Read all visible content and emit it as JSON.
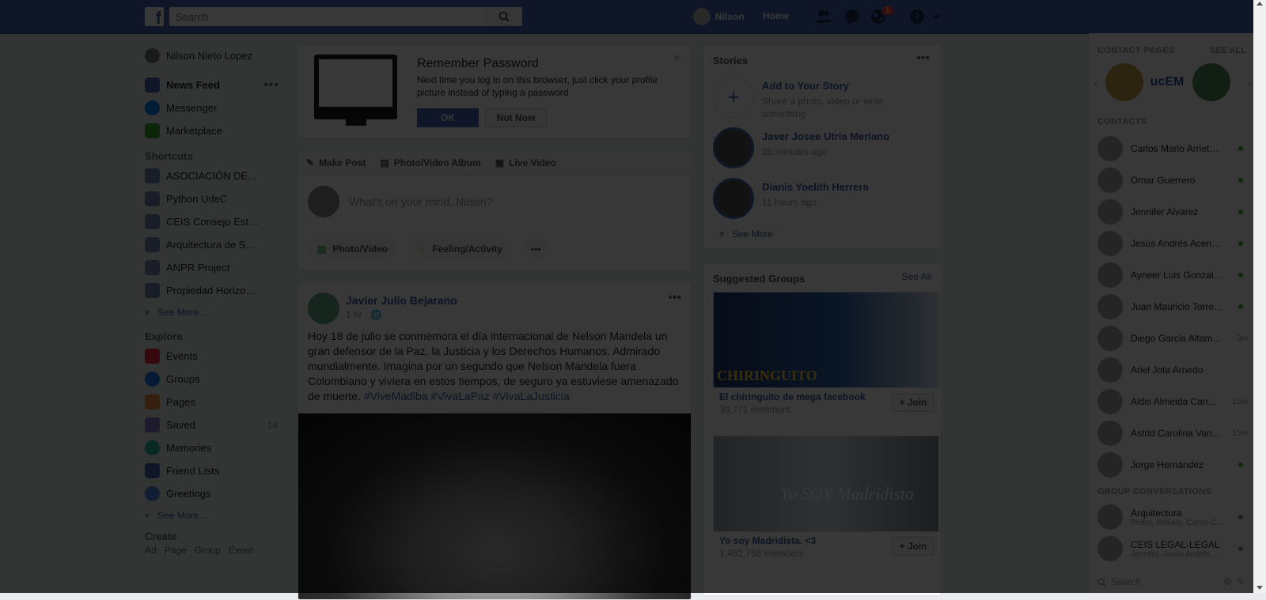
{
  "topbar": {
    "logo": "f",
    "search_placeholder": "Search",
    "user_name": "Nilson",
    "home_label": "Home",
    "notifications_count": "1"
  },
  "leftnav": {
    "profile": "Nilson Nieto Lopez",
    "main": [
      {
        "label": "News Feed",
        "icon": "news-feed-icon",
        "color": "#4267b2"
      },
      {
        "label": "Messenger",
        "icon": "messenger-icon",
        "color": "#0084ff"
      },
      {
        "label": "Marketplace",
        "icon": "marketplace-icon",
        "color": "#36a420"
      }
    ],
    "shortcuts_title": "Shortcuts",
    "shortcuts": [
      {
        "label": "ASOCIACIÓN DE..."
      },
      {
        "label": "Python UdeC"
      },
      {
        "label": "CEIS Consejo Estu..."
      },
      {
        "label": "Arquitectura de Sof..."
      },
      {
        "label": "ANPR Project"
      },
      {
        "label": "Propiedad Horizontal"
      }
    ],
    "shortcuts_see_more": "See More...",
    "explore_title": "Explore",
    "explore": [
      {
        "label": "Events",
        "count": "",
        "color": "#f02849"
      },
      {
        "label": "Groups",
        "count": "",
        "color": "#1877f2"
      },
      {
        "label": "Pages",
        "count": "",
        "color": "#f7923b"
      },
      {
        "label": "Saved",
        "count": "14",
        "color": "#8c72cb"
      },
      {
        "label": "Memories",
        "count": "",
        "color": "#2abba7"
      },
      {
        "label": "Friend Lists",
        "count": "",
        "color": "#4267b2"
      },
      {
        "label": "Greetings",
        "count": "",
        "color": "#4b8ee8"
      }
    ],
    "explore_see_more": "See More...",
    "create_title": "Create",
    "create_links": [
      "Ad",
      "Page",
      "Group",
      "Event"
    ]
  },
  "remember": {
    "title": "Remember Password",
    "body": "Next time you log in on this browser, just click your profile picture instead of typing a password",
    "ok_label": "OK",
    "not_now_label": "Not Now",
    "close": "×"
  },
  "composer": {
    "tabs": [
      "Make Post",
      "Photo/Video Album",
      "Live Video"
    ],
    "placeholder": "What's on your mind, Nilson?",
    "actions": [
      "Photo/Video",
      "Feeling/Activity",
      "•••"
    ]
  },
  "post": {
    "author": "Javier Julio Bejarano",
    "time": "1 hr · 🌐",
    "text": "Hoy 18 de julio se conmemora el día internacional de Nelson Mandela un gran defensor de la Paz, la Justicia y los Derechos Humanos. Admirado mundialmente. Imagina por un segundo que Nelson Mandela fuera Colombiano y viviera en estos tiempos, de seguro ya estuviese amenazado de muerte.",
    "tags": "#ViveMadiba #VivaLaPaz #VivaLaJusticia"
  },
  "stories": {
    "title": "Stories",
    "add_title": "Add to Your Story",
    "add_sub": "Share a photo, video or write something",
    "items": [
      {
        "name": "Javer Josee Utria Merlano",
        "time": "26 minutes ago"
      },
      {
        "name": "Dianis Yoelith Herrera",
        "time": "11 hours ago"
      }
    ],
    "see_more": "See More"
  },
  "groups": {
    "title": "Suggested Groups",
    "see_all": "See All",
    "items": [
      {
        "name": "El chiringuito de mega facebook",
        "members": "39,771 members",
        "join": "+ Join",
        "banner": "CHIRINGUITO"
      },
      {
        "name": "Yo soy Madridista. <3",
        "members": "1,482,758 members",
        "join": "+ Join",
        "banner": "Yo SOY Madridista"
      }
    ]
  },
  "chat": {
    "contact_pages_title": "CONTACT PAGES",
    "see_all": "SEE ALL",
    "contact_page_logo": "ucEM",
    "contacts_title": "CONTACTS",
    "contacts": [
      {
        "name": "Carlos Mario Arrieta ...",
        "status": "online",
        "time": ""
      },
      {
        "name": "Omar Guerrero",
        "status": "online",
        "time": ""
      },
      {
        "name": "Jennifer Alvarez",
        "status": "online",
        "time": ""
      },
      {
        "name": "Jesús Andrés Acend...",
        "status": "online",
        "time": ""
      },
      {
        "name": "Ayneer Luis Gonzale...",
        "status": "online",
        "time": ""
      },
      {
        "name": "Juan Mauricio Torres ...",
        "status": "online",
        "time": ""
      },
      {
        "name": "Diego Garcia Altamir...",
        "status": "away",
        "time": "3m"
      },
      {
        "name": "Ariel Jota Arnedo",
        "status": "none",
        "time": ""
      },
      {
        "name": "Aldis Almeida Carr...",
        "status": "away",
        "time": "15m"
      },
      {
        "name": "Astrid Carolina Van...",
        "status": "away",
        "time": "15m"
      },
      {
        "name": "Jorge Hernández",
        "status": "online",
        "time": ""
      }
    ],
    "group_conv_title": "GROUP CONVERSATIONS",
    "groups": [
      {
        "name": "Arquitectura",
        "sub": "Pedro, William, Carlos Cara..."
      },
      {
        "name": "CEIS LEGAL-LEGAL",
        "sub": "Jennifer, Jesús Andrés, Br..."
      }
    ],
    "search_placeholder": "Search"
  }
}
